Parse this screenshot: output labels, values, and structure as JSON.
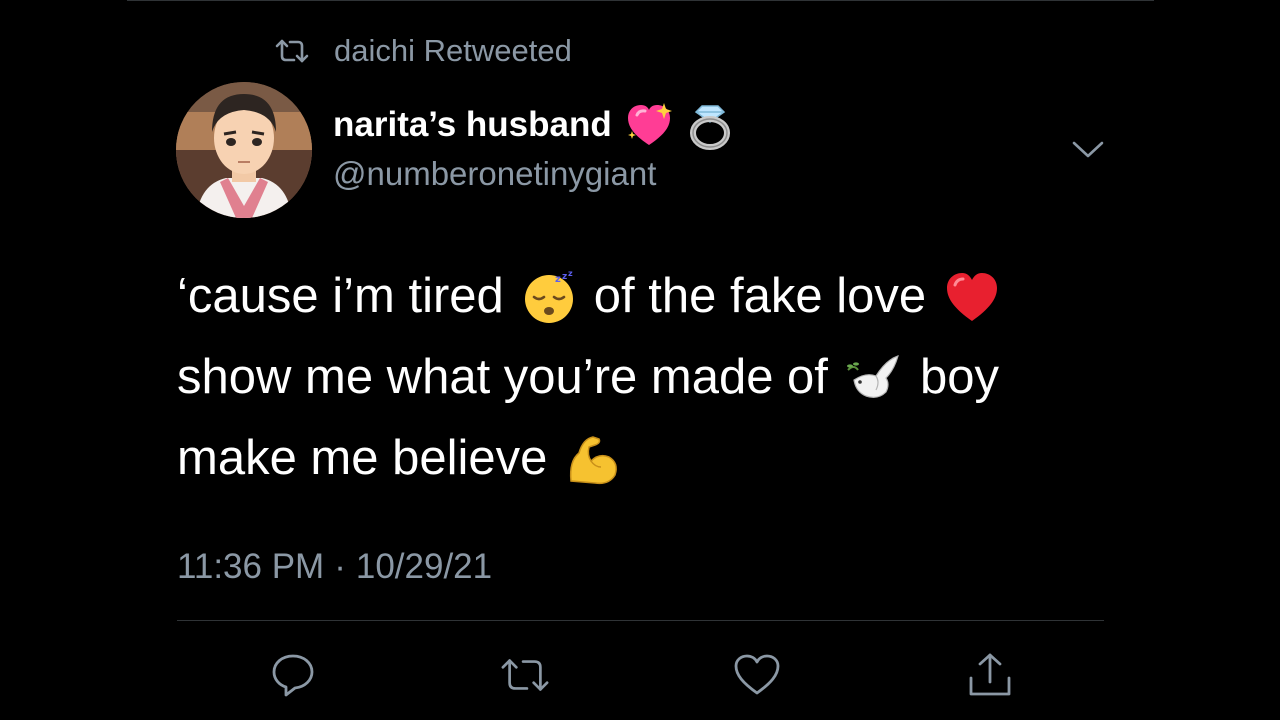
{
  "retweet_context": {
    "text": "daichi Retweeted",
    "icon": "retweet-icon"
  },
  "author": {
    "display_name": "narita’s husband",
    "name_emojis": [
      "sparkling-heart-icon",
      "ring-icon"
    ],
    "handle": "@numberonetinygiant"
  },
  "tweet": {
    "lines": [
      {
        "before": "‘cause i’m tired",
        "emoji": "sleeping-face-icon",
        "after": "of the fake love",
        "emoji2": "red-heart-icon"
      },
      {
        "before": "show me what you’re made of",
        "emoji": "dove-icon",
        "after": "boy"
      },
      {
        "before": "make me believe",
        "emoji": "flexed-biceps-icon"
      }
    ]
  },
  "meta": {
    "time": "11:36 PM",
    "separator": "·",
    "date": "10/29/21"
  },
  "actions": [
    "reply-icon",
    "retweet-icon",
    "like-icon",
    "share-icon"
  ],
  "colors": {
    "background": "#000000",
    "text": "#ffffff",
    "secondary": "#8b98a5",
    "divider": "#2f3336"
  }
}
